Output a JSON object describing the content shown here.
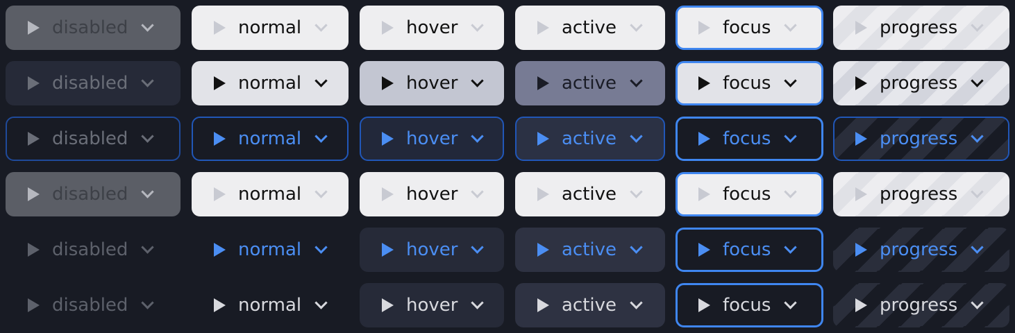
{
  "rows": [
    {
      "theme": "light",
      "buttons": [
        {
          "state": "disabled",
          "label": "disabled"
        },
        {
          "state": "normal",
          "label": "normal"
        },
        {
          "state": "hover",
          "label": "hover"
        },
        {
          "state": "active",
          "label": "active"
        },
        {
          "state": "focus",
          "label": "focus"
        },
        {
          "state": "progress",
          "label": "progress"
        }
      ]
    },
    {
      "theme": "gray",
      "buttons": [
        {
          "state": "disabled",
          "label": "disabled"
        },
        {
          "state": "normal",
          "label": "normal"
        },
        {
          "state": "hover",
          "label": "hover"
        },
        {
          "state": "active",
          "label": "active"
        },
        {
          "state": "focus",
          "label": "focus"
        },
        {
          "state": "progress",
          "label": "progress"
        }
      ]
    },
    {
      "theme": "outline",
      "buttons": [
        {
          "state": "disabled",
          "label": "disabled"
        },
        {
          "state": "normal",
          "label": "normal"
        },
        {
          "state": "hover",
          "label": "hover"
        },
        {
          "state": "active",
          "label": "active"
        },
        {
          "state": "focus",
          "label": "focus"
        },
        {
          "state": "progress",
          "label": "progress"
        }
      ]
    },
    {
      "theme": "light",
      "buttons": [
        {
          "state": "disabled",
          "label": "disabled"
        },
        {
          "state": "normal",
          "label": "normal"
        },
        {
          "state": "hover",
          "label": "hover"
        },
        {
          "state": "active",
          "label": "active"
        },
        {
          "state": "focus",
          "label": "focus"
        },
        {
          "state": "progress",
          "label": "progress"
        }
      ]
    },
    {
      "theme": "ghost",
      "buttons": [
        {
          "state": "disabled",
          "label": "disabled"
        },
        {
          "state": "normal",
          "label": "normal"
        },
        {
          "state": "hover",
          "label": "hover"
        },
        {
          "state": "active",
          "label": "active"
        },
        {
          "state": "focus",
          "label": "focus"
        },
        {
          "state": "progress",
          "label": "progress"
        }
      ]
    },
    {
      "theme": "ghostw",
      "buttons": [
        {
          "state": "disabled",
          "label": "disabled"
        },
        {
          "state": "normal",
          "label": "normal"
        },
        {
          "state": "hover",
          "label": "hover"
        },
        {
          "state": "active",
          "label": "active"
        },
        {
          "state": "focus",
          "label": "focus"
        },
        {
          "state": "progress",
          "label": "progress"
        }
      ]
    }
  ],
  "icons": {
    "leading": "play-icon",
    "trailing": "chevron-down-icon"
  },
  "colors": {
    "background": "#181b24",
    "accent": "#4b8ef3",
    "focus_ring": "#3f86f0"
  }
}
